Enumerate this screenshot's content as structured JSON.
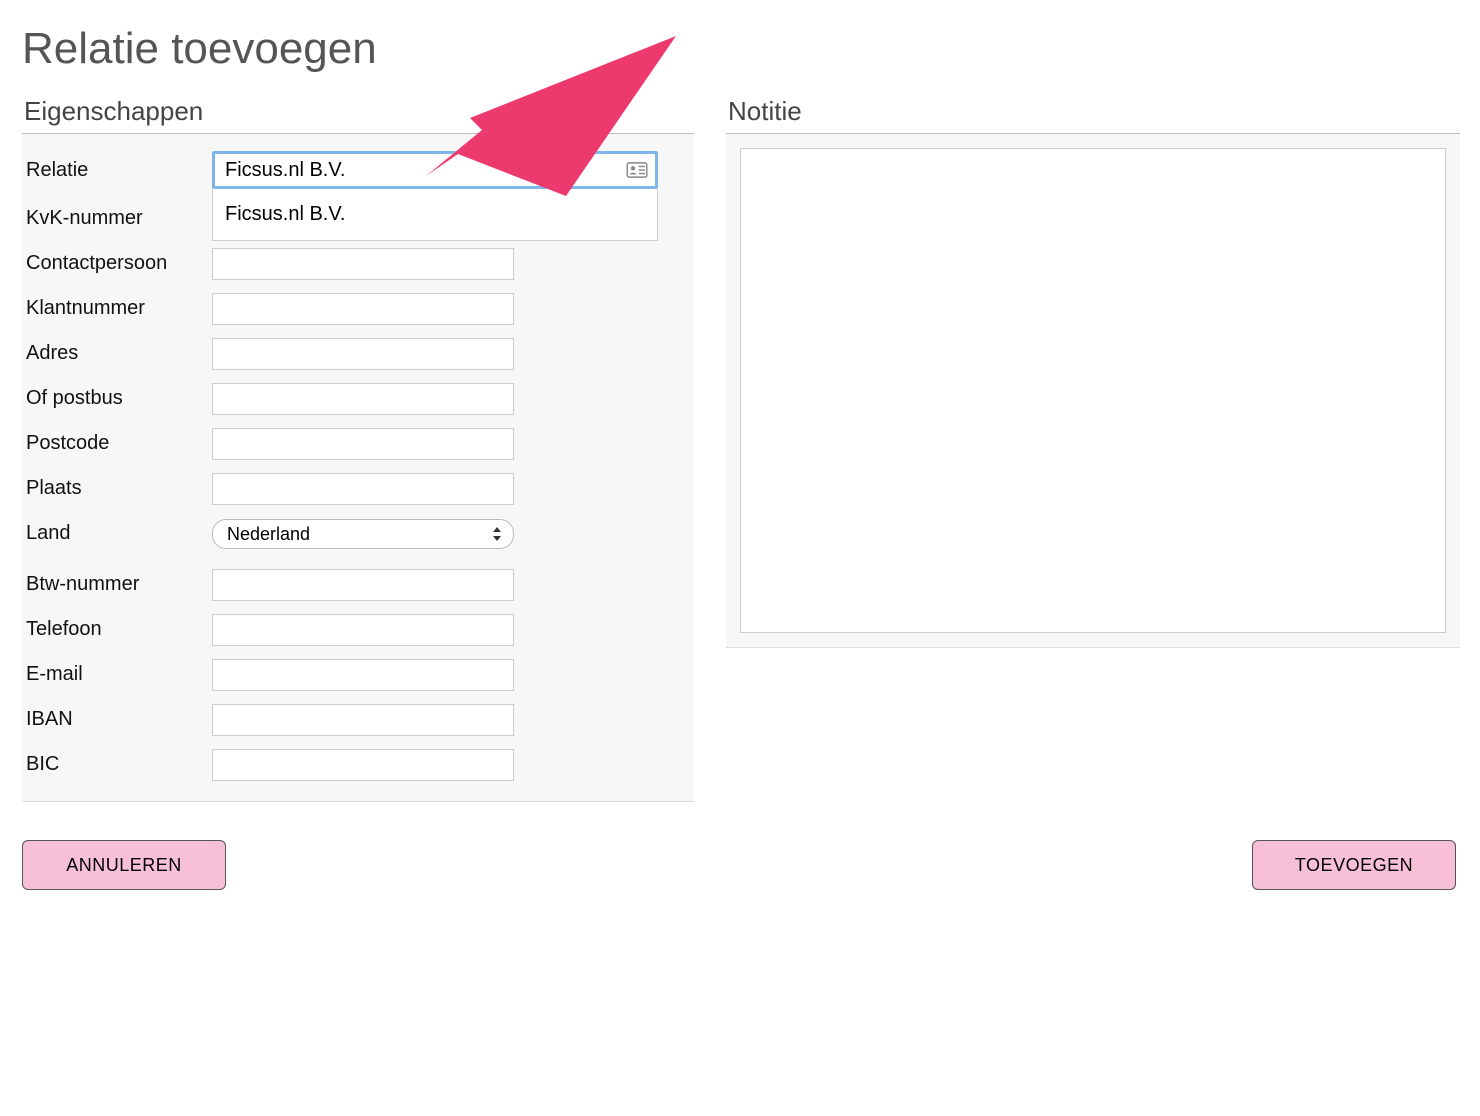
{
  "page": {
    "title": "Relatie toevoegen"
  },
  "sections": {
    "properties_heading": "Eigenschappen",
    "note_heading": "Notitie"
  },
  "fields": {
    "relatie": {
      "label": "Relatie",
      "value": "Ficsus.nl B.V."
    },
    "kvk": {
      "label": "KvK-nummer",
      "value": ""
    },
    "contactpersoon": {
      "label": "Contactpersoon",
      "value": ""
    },
    "klantnummer": {
      "label": "Klantnummer",
      "value": ""
    },
    "adres": {
      "label": "Adres",
      "value": ""
    },
    "postbus": {
      "label": "Of postbus",
      "value": ""
    },
    "postcode": {
      "label": "Postcode",
      "value": ""
    },
    "plaats": {
      "label": "Plaats",
      "value": ""
    },
    "land": {
      "label": "Land",
      "selected": "Nederland"
    },
    "btw": {
      "label": "Btw-nummer",
      "value": ""
    },
    "telefoon": {
      "label": "Telefoon",
      "value": ""
    },
    "email": {
      "label": "E-mail",
      "value": ""
    },
    "iban": {
      "label": "IBAN",
      "value": ""
    },
    "bic": {
      "label": "BIC",
      "value": ""
    }
  },
  "autocomplete": {
    "items": [
      "Ficsus.nl B.V."
    ]
  },
  "note": {
    "value": ""
  },
  "buttons": {
    "cancel": "ANNULEREN",
    "submit": "TOEVOEGEN"
  },
  "colors": {
    "focus_border": "#7fb5e8",
    "button_bg": "#f7c0d8",
    "arrow": "#ec3a6e"
  }
}
